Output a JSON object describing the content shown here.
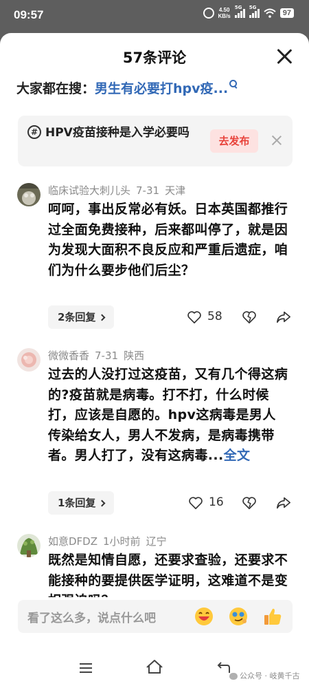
{
  "status_bar": {
    "time": "09:57",
    "net_speed_value": "4.50",
    "net_speed_unit": "KB/s",
    "sim1": "5G",
    "sim2": "5G",
    "battery": "97"
  },
  "sheet": {
    "title": "57条评论",
    "hot_search_label": "大家都在搜：",
    "hot_search_term": "男生有必要打hpv疫..."
  },
  "topic": {
    "icon": "#",
    "text": "HPV疫苗接种是入学必要吗",
    "publish_label": "去发布"
  },
  "comments": [
    {
      "user": "临床试验大刺儿头",
      "date": "7-31",
      "location": "天津",
      "text": "呵呵，事出反常必有妖。日本英国都推行过全面免费接种，后来都叫停了，就是因为发现大面积不良反应和严重后遗症，咱们为什么要步他们后尘？",
      "more": "",
      "reply_label": "2条回复",
      "likes": "58"
    },
    {
      "user": "微微香香",
      "date": "7-31",
      "location": "陕西",
      "text": "过去的人没打过这疫苗，又有几个得这病的?疫苗就是病毒。打不打，什么时候打，应该是自愿的。hpv这病毒是男人传染给女人，男人不发病，是病毒携带者。男人打了，没有这病毒...",
      "more": "全文",
      "reply_label": "1条回复",
      "likes": "16"
    },
    {
      "user": "如意DFDZ",
      "date": "1小时前",
      "location": "辽宁",
      "text": "既然是知情自愿，还要求查验，还要求不能接种的要提供医学证明，这难道不是变相强迫吗？",
      "more": "",
      "reply_label": "",
      "likes": ""
    }
  ],
  "input": {
    "placeholder": "看了这么多，说点什么吧"
  },
  "watermark": "公众号 · 岐黄千古",
  "colors": {
    "accent_blue": "#3269b6",
    "publish_red": "#e8423a",
    "publish_bg": "#fde2e1",
    "card_bg": "#f4f4f4"
  }
}
